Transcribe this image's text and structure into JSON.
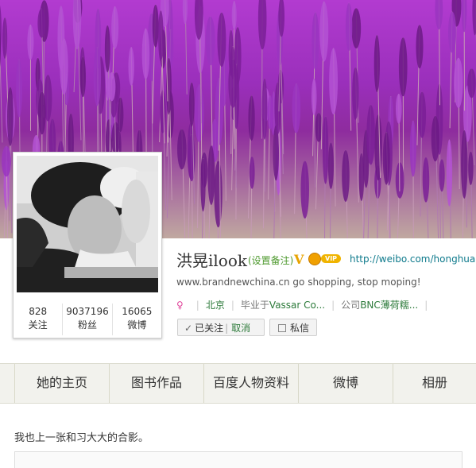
{
  "profile": {
    "name": "洪晃ilook",
    "remark_link": "(设置备注)",
    "verified_badge": "V",
    "vip_badge": "VIP",
    "homepage_url": "http://weibo.com/honghuang",
    "bio": "www.brandnewchina.cn go shopping, stop moping!",
    "sex_icon": "female-icon",
    "location": "北京",
    "education_prefix": "毕业于",
    "education": "Vassar Co...",
    "company_prefix": "公司",
    "company": "BNC薄荷糯...",
    "separator": "|"
  },
  "stats": [
    {
      "value": "828",
      "label": "关注"
    },
    {
      "value": "9037196",
      "label": "粉丝"
    },
    {
      "value": "16065",
      "label": "微博"
    }
  ],
  "buttons": {
    "followed": "已关注",
    "followed_sep": "|",
    "cancel": "取消",
    "message": "私信"
  },
  "tabs": [
    "她的主页",
    "图书作品",
    "百度人物资料",
    "微博",
    "相册"
  ],
  "post": {
    "text": "我也上一张和习大大的合影。"
  },
  "colors": {
    "cover_purple": "#9a2fbb",
    "link_green": "#2c7a3a",
    "url_teal": "#0e7a8c",
    "badge_gold": "#e8a300"
  }
}
